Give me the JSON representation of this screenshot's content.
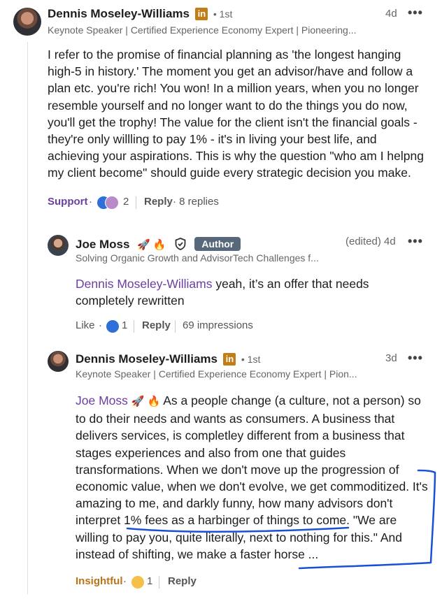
{
  "comment1": {
    "author": "Dennis Moseley-Williams",
    "linkedin_badge": "in",
    "degree": "• 1st",
    "time": "4d",
    "more": "•••",
    "headline": "Keynote Speaker | Certified Experience Economy Expert | Pioneering...",
    "body_lines": [
      "I refer to the promise of financial planning as 'the longest hanging",
      "high-5 in history.' The moment you get an advisor/have and follow a",
      "plan etc. you're rich! You won! In a million years, when you no longer",
      "resemble yourself and no longer want to do the things you do now,",
      "you'll get the trophy! The value for the client isn't the financial goals -",
      "they're only willling to pay 1% - it's in living your best life, and",
      "achieving your aspirations. This is why the question \"who am I helpng",
      "my client become\" should guide every strategic decision you make."
    ],
    "reaction_label": "Support",
    "reaction_dot": "·",
    "reaction_count": "2",
    "reply_label": "Reply",
    "replies_count": "· 8 replies"
  },
  "reply1": {
    "author": "Joe Moss",
    "emojis": "🚀 🔥",
    "author_badge": "Author",
    "edited_time": "(edited) 4d",
    "more": "•••",
    "headline": "Solving Organic Growth and AdvisorTech Challenges f...",
    "mention": "Dennis Moseley-Williams",
    "body_line1_rest": " yeah, it’s an offer that needs",
    "body_line2": "completely rewritten",
    "reaction_label": "Like",
    "reaction_dot": "·",
    "reaction_count": "1",
    "reply_label": "Reply",
    "impressions": "69 impressions"
  },
  "reply2": {
    "author": "Dennis Moseley-Williams",
    "linkedin_badge": "in",
    "degree": "• 1st",
    "time": "3d",
    "more": "•••",
    "headline": "Keynote Speaker | Certified Experience Economy Expert | Pion...",
    "mention": "Joe Moss",
    "emojis": "🚀 🔥",
    "body_line1_rest": "As a people change (a culture, not a person) so",
    "body_lines": [
      "to do their needs and wants as consumers. A business that",
      "delivers services, is completley different from a business that",
      "stages experiences and also from one that guides",
      "transformations. When we don't move up the progression of",
      "economic value, when we don't evolve, we get commoditized. It's",
      "amazing to me, and darkly funny, how many advisors don't",
      "interpret 1% fees as a harbinger of things to come. \"We are",
      "willing to pay you, quite literally, next to nothing for this.\" And",
      "instead of shifting, we make a faster horse ..."
    ],
    "reaction_label": "Insightful",
    "reaction_dot": "·",
    "reaction_count": "1",
    "reply_label": "Reply"
  },
  "colors": {
    "mention": "#6b3fa0",
    "annotation_ink": "#1a4fd6",
    "insightful": "#b9741a",
    "support": "#6b3fa0"
  },
  "icons": {
    "shield": "shield-icon",
    "like": "like-reaction-icon",
    "support": "support-reaction-icon",
    "insightful": "insightful-reaction-icon"
  }
}
